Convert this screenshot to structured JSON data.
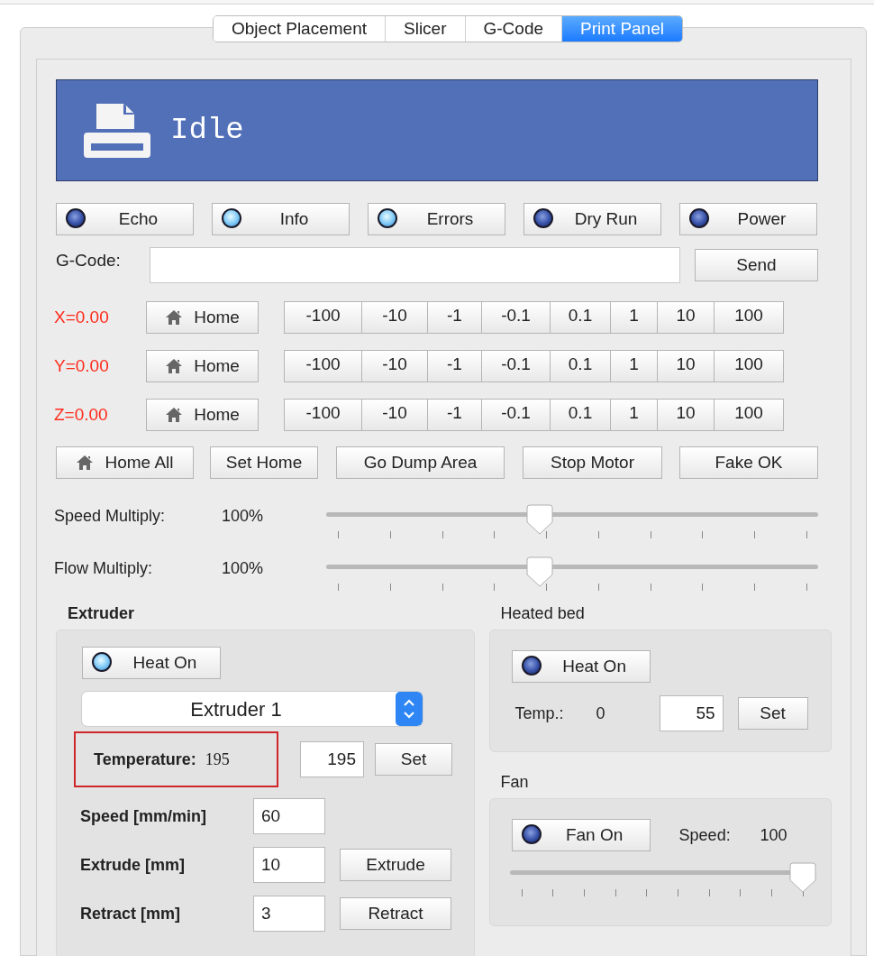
{
  "tabs": [
    {
      "label": "Object Placement",
      "selected": false
    },
    {
      "label": "Slicer",
      "selected": false
    },
    {
      "label": "G-Code",
      "selected": false
    },
    {
      "label": "Print Panel",
      "selected": true
    }
  ],
  "status": {
    "text": "Idle"
  },
  "toggles": [
    {
      "label": "Echo",
      "on": false
    },
    {
      "label": "Info",
      "on": true
    },
    {
      "label": "Errors",
      "on": true
    },
    {
      "label": "Dry Run",
      "on": false
    },
    {
      "label": "Power",
      "on": false
    }
  ],
  "gcode": {
    "label": "G-Code:",
    "button": "Send"
  },
  "axes": [
    {
      "position": "X=0.00",
      "home": "Home",
      "steps": [
        "-100",
        "-10",
        "-1",
        "-0.1",
        "0.1",
        "1",
        "10",
        "100"
      ]
    },
    {
      "position": "Y=0.00",
      "home": "Home",
      "steps": [
        "-100",
        "-10",
        "-1",
        "-0.1",
        "0.1",
        "1",
        "10",
        "100"
      ]
    },
    {
      "position": "Z=0.00",
      "home": "Home",
      "steps": [
        "-100",
        "-10",
        "-1",
        "-0.1",
        "0.1",
        "1",
        "10",
        "100"
      ]
    }
  ],
  "actions": [
    {
      "label": "Home All",
      "kind": "home"
    },
    {
      "label": "Set Home",
      "kind": "plain"
    },
    {
      "label": "Go Dump Area",
      "kind": "plain"
    },
    {
      "label": "Stop Motor",
      "kind": "plain"
    },
    {
      "label": "Fake OK",
      "kind": "plain"
    }
  ],
  "multipliers": [
    {
      "label": "Speed Multiply:",
      "reading": "100%",
      "level": 0.43
    },
    {
      "label": "Flow Multiply:",
      "reading": "100%",
      "level": 0.43
    }
  ],
  "extruder": {
    "title": "Extruder",
    "heat": {
      "label": "Heat On",
      "on": true
    },
    "select": "Extruder 1",
    "temperature": {
      "label": "Temperature:",
      "reading": "195",
      "value": "195",
      "button": "Set",
      "highlighted": true
    },
    "speed": {
      "label": "Speed [mm/min]",
      "value": "60"
    },
    "extrude": {
      "label": "Extrude [mm]",
      "value": "10",
      "button": "Extrude"
    },
    "retract": {
      "label": "Retract [mm]",
      "value": "3",
      "button": "Retract"
    }
  },
  "heated_bed": {
    "title": "Heated bed",
    "heat": {
      "label": "Heat On",
      "on": false
    },
    "label": "Temp.:",
    "reading": "0",
    "value": "55",
    "button": "Set"
  },
  "fan": {
    "title": "Fan",
    "toggle": {
      "label": "Fan On",
      "on": false
    },
    "speed_label": "Speed:",
    "reading": "100",
    "level": 1.0
  }
}
